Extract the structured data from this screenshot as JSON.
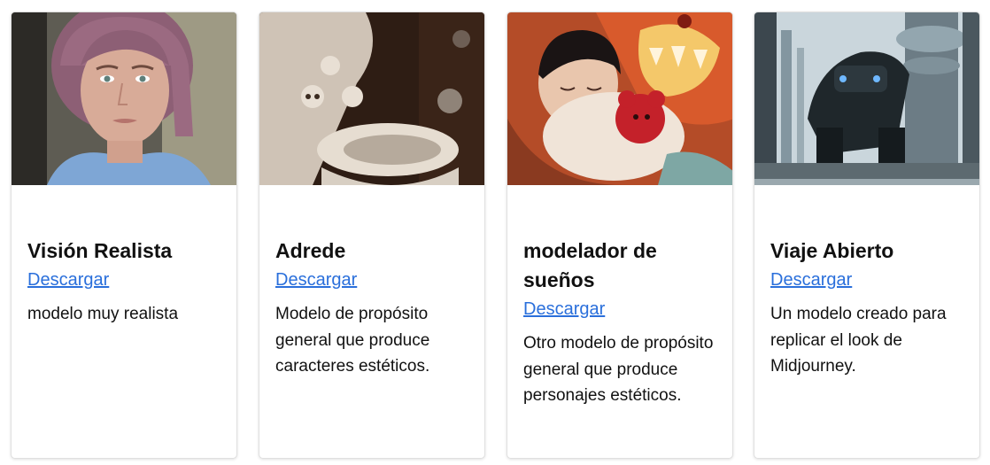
{
  "cards": [
    {
      "title": "Visión Realista",
      "link_label": "Descargar",
      "description": "modelo muy realista",
      "thumb_colors": [
        "#6f6d62",
        "#8d5f75",
        "#c89c89",
        "#7ea6d5"
      ]
    },
    {
      "title": "Adrede",
      "link_label": "Descargar",
      "description": "Modelo de propósito general que produce caracteres estéticos.",
      "thumb_colors": [
        "#3a261c",
        "#bba999",
        "#e2d9cf",
        "#1d120d"
      ]
    },
    {
      "title": "modelador de sueños",
      "link_label": "Descargar",
      "description": "Otro modelo de propósito general que produce personajes estéticos.",
      "thumb_colors": [
        "#c6532a",
        "#efc46a",
        "#f2e3d5",
        "#b8202a"
      ]
    },
    {
      "title": "Viaje Abierto",
      "link_label": "Descargar",
      "description": "Un modelo creado para replicar el look de Midjourney.",
      "thumb_colors": [
        "#cfdbe0",
        "#51606a",
        "#1d2327",
        "#8fa3ad"
      ]
    }
  ]
}
